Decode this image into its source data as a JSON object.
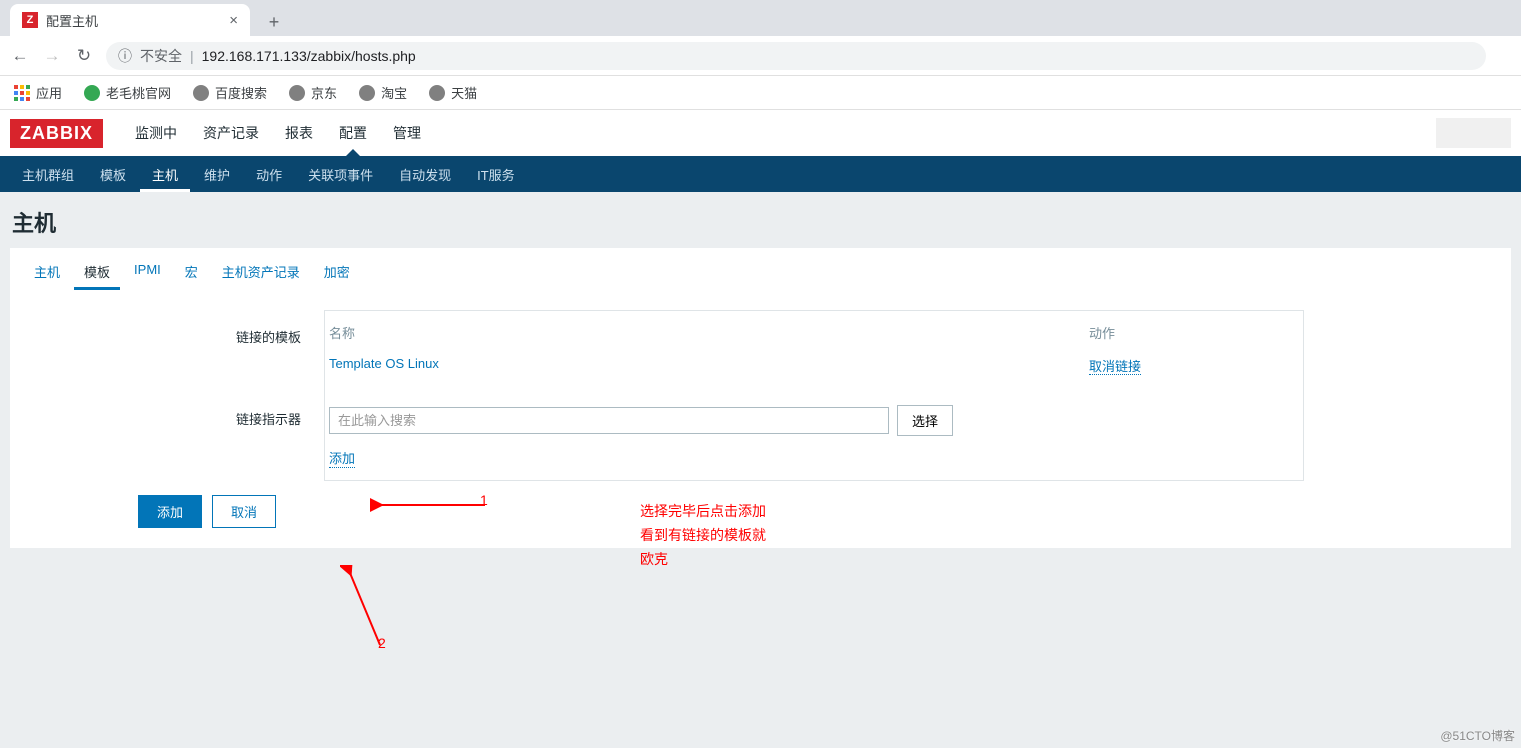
{
  "browser": {
    "tab": {
      "favicon_letter": "Z",
      "title": "配置主机",
      "close": "×",
      "new_tab": "+"
    },
    "nav_back": "←",
    "nav_fwd": "→",
    "reload": "↻",
    "insecure_icon": "ⓘ",
    "insecure_label": "不安全",
    "sep": "|",
    "url": "192.168.171.133/zabbix/hosts.php",
    "bookmarks": {
      "apps": "应用",
      "items": [
        {
          "label": "老毛桃官网",
          "color": "#34a853"
        },
        {
          "label": "百度搜索",
          "color": "#808080"
        },
        {
          "label": "京东",
          "color": "#808080"
        },
        {
          "label": "淘宝",
          "color": "#808080"
        },
        {
          "label": "天猫",
          "color": "#808080"
        }
      ]
    }
  },
  "zabbix": {
    "logo": "ZABBIX",
    "top_nav": [
      "监测中",
      "资产记录",
      "报表",
      "配置",
      "管理"
    ],
    "top_nav_active": 3,
    "sub_nav": [
      "主机群组",
      "模板",
      "主机",
      "维护",
      "动作",
      "关联项事件",
      "自动发现",
      "IT服务"
    ],
    "sub_nav_active": 2,
    "page_title": "主机",
    "hz_tabs": [
      "主机",
      "模板",
      "IPMI",
      "宏",
      "主机资产记录",
      "加密"
    ],
    "hz_tabs_active": 1,
    "linked_templates": {
      "label": "链接的模板",
      "head_name": "名称",
      "head_action": "动作",
      "rows": [
        {
          "name": "Template OS Linux",
          "action": "取消链接"
        }
      ]
    },
    "link_indicator": {
      "label": "链接指示器",
      "placeholder": "在此输入搜索",
      "select_btn": "选择",
      "add_link": "添加"
    },
    "buttons": {
      "submit": "添加",
      "cancel": "取消"
    }
  },
  "annot": {
    "num1": "1",
    "num2": "2",
    "note_l1": "选择完毕后点击添加",
    "note_l2": "看到有链接的模板就",
    "note_l3": "欧克"
  },
  "watermark": "@51CTO博客"
}
